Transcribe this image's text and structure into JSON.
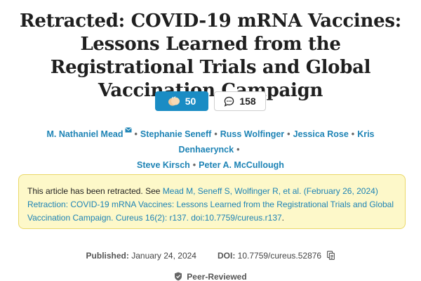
{
  "article": {
    "title_prefix": "Retracted",
    "title_rest": ": COVID-19 mRNA Vaccines: Lessons Learned from the Registrational Trials and Global Vaccination Campaign"
  },
  "stats": {
    "likes": "50",
    "comments": "158"
  },
  "authors": [
    "M. Nathaniel Mead",
    "Stephanie Seneff",
    "Russ Wolfinger",
    "Jessica Rose",
    "Kris Denhaerynck",
    "Steve Kirsch",
    "Peter A. McCullough"
  ],
  "retraction": {
    "lead": "This article has been retracted. See ",
    "link": "Mead M, Seneff S, Wolfinger R, et al. (February 26, 2024) Retraction: COVID-19 mRNA Vaccines: Lessons Learned from the Registrational Trials and Global Vaccination Campaign. Cureus 16(2): r137. doi:10.7759/cureus.r137",
    "tail": "."
  },
  "meta": {
    "published_label": "Published:",
    "published_date": "January 24, 2024",
    "doi_label": "DOI:",
    "doi_value": "10.7759/cureus.52876"
  },
  "peer_review": "Peer-Reviewed",
  "colors": {
    "link": "#1d83b5",
    "likes_bg": "#1a8cc4",
    "notice_bg": "#fdf8c9",
    "notice_border": "#ead86a"
  },
  "icons": [
    "clap-hands-icon",
    "comment-bubble-icon",
    "mail-icon",
    "copy-icon",
    "shield-check-icon"
  ]
}
